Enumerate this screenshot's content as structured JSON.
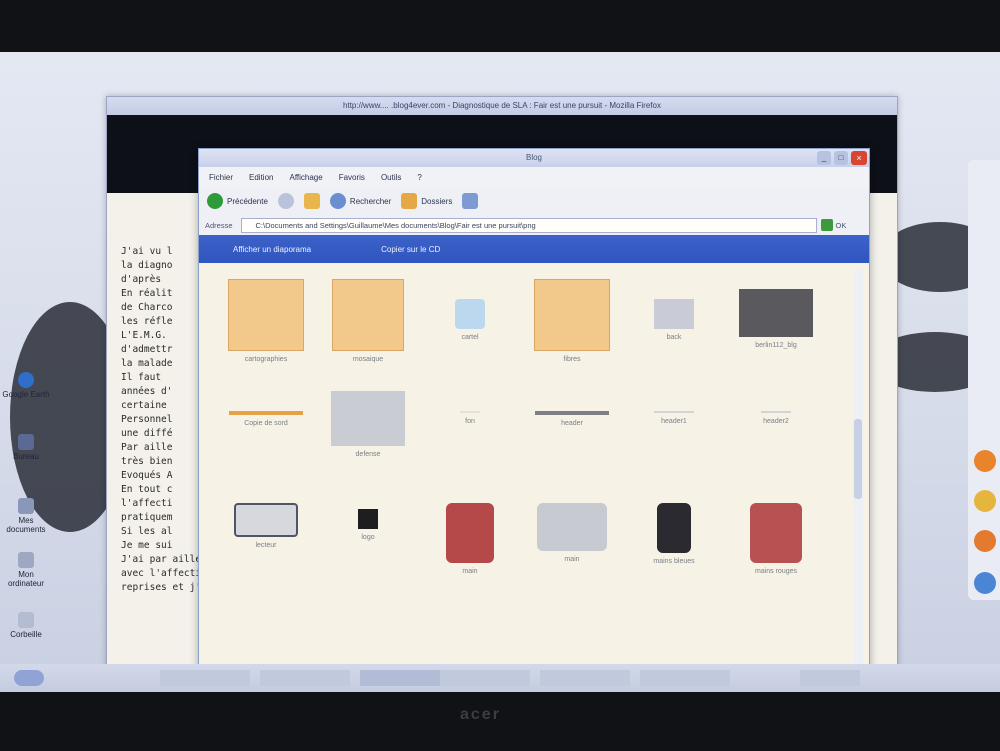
{
  "browser": {
    "title": "http://www.... .blog4ever.com - Diagnostique de SLA : Fair est une pursuit - Mozilla Firefox",
    "content_lines": [
      "J'ai vu l",
      "la diagno",
      "d'après",
      "En réalit",
      "de Charco",
      "les réfle",
      "L'E.M.G.",
      "d'admettr",
      "la malade",
      "Il faut",
      "années d'",
      "certaine",
      "Personnel",
      "une diffé",
      "Par aille",
      "très bien",
      "Evoqués A",
      "En tout c",
      "l'affecti",
      "pratiquem",
      "Si les al",
      "Je me sui",
      "J'ai par ailleurs demandé une radiographie de la colonne cervicale pour éliminer une coexistence",
      "avec l'affection neurologique des côtes cervicales - éventualité que j'ai rencontré à différentes",
      "reprises et j'ai inspiré une Thèse récente à un de mes élèves sur le sujet."
    ]
  },
  "explorer": {
    "title": "Blog",
    "menu": [
      "Fichier",
      "Edition",
      "Affichage",
      "Favoris",
      "Outils",
      "?"
    ],
    "toolbar": {
      "back_label": "Précédente",
      "search_label": "Rechercher",
      "folders_label": "Dossiers"
    },
    "address": {
      "label": "Adresse",
      "value": "C:\\Documents and Settings\\Guillaume\\Mes documents\\Blog\\Fair est une pursuit\\png",
      "go_label": "OK"
    },
    "tasks": {
      "slideshow_label": "Afficher un diaporama",
      "copy_label": "Copier sur le CD"
    },
    "files": [
      {
        "name": "cartographies"
      },
      {
        "name": "mosaique"
      },
      {
        "name": "cartel"
      },
      {
        "name": "fibres"
      },
      {
        "name": "back"
      },
      {
        "name": "berlin112_blg"
      },
      {
        "name": "Copie de sord"
      },
      {
        "name": "defense"
      },
      {
        "name": "fon"
      },
      {
        "name": "header"
      },
      {
        "name": "header1"
      },
      {
        "name": "header2"
      },
      {
        "name": "lecteur"
      },
      {
        "name": "logo"
      },
      {
        "name": "main"
      },
      {
        "name": "main"
      },
      {
        "name": "mains bleues"
      },
      {
        "name": "mains rouges"
      }
    ]
  },
  "desktop": {
    "icons": [
      "Google Earth",
      "Bureau",
      "Mes documents",
      "Mon ordinateur",
      "Corbeille"
    ]
  },
  "monitor": {
    "brand": "acer"
  },
  "colors": {
    "taskpane": "#2f55bf",
    "folder": "#f2c98b"
  }
}
